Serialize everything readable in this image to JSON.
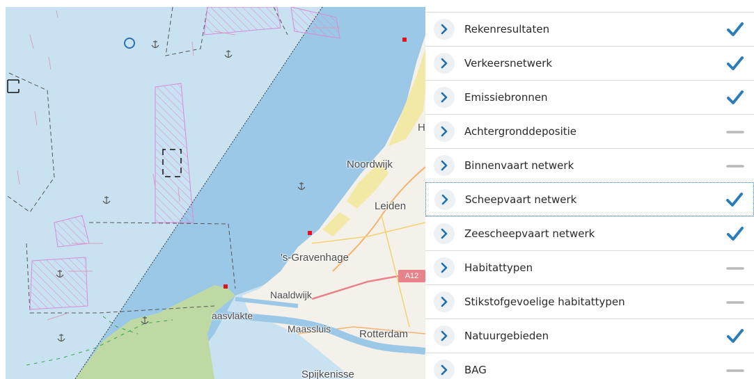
{
  "colors": {
    "sea": "#c9e2f1",
    "deep_water": "#9ac8e6",
    "land": "#f4f1ea",
    "dunes": "#f3e9a6",
    "nature": "#bfd9a5",
    "check": "#2b7cb8",
    "dash": "#b9b9b9"
  },
  "map": {
    "labels": {
      "noordwijk": "Noordwijk",
      "leiden": "Leiden",
      "gravenhage": "'s-Gravenhage",
      "naaldwijk": "Naaldwijk",
      "maasvlakte": "aasvlakte",
      "maassluis": "Maassluis",
      "rotterdam": "Rotterdam",
      "spijkenisse": "Spijkenisse",
      "h": "H",
      "road": "A12"
    }
  },
  "layers": [
    {
      "label": "Rekenresultaten",
      "state": "checked",
      "icon": "checkmark-icon"
    },
    {
      "label": "Verkeersnetwerk",
      "state": "checked",
      "icon": "checkmark-icon"
    },
    {
      "label": "Emissiebronnen",
      "state": "checked",
      "icon": "checkmark-icon"
    },
    {
      "label": "Achtergronddepositie",
      "state": "unchecked",
      "icon": "dash-icon"
    },
    {
      "label": "Binnenvaart netwerk",
      "state": "unchecked",
      "icon": "dash-icon"
    },
    {
      "label": "Scheepvaart netwerk",
      "state": "checked",
      "icon": "checkmark-icon",
      "focused": true
    },
    {
      "label": "Zeescheepvaart netwerk",
      "state": "checked",
      "icon": "checkmark-icon"
    },
    {
      "label": "Habitattypen",
      "state": "unchecked",
      "icon": "dash-icon"
    },
    {
      "label": "Stikstofgevoelige habitattypen",
      "state": "unchecked",
      "icon": "dash-icon"
    },
    {
      "label": "Natuurgebieden",
      "state": "checked",
      "icon": "checkmark-icon"
    },
    {
      "label": "BAG",
      "state": "unchecked",
      "icon": "dash-icon"
    }
  ]
}
